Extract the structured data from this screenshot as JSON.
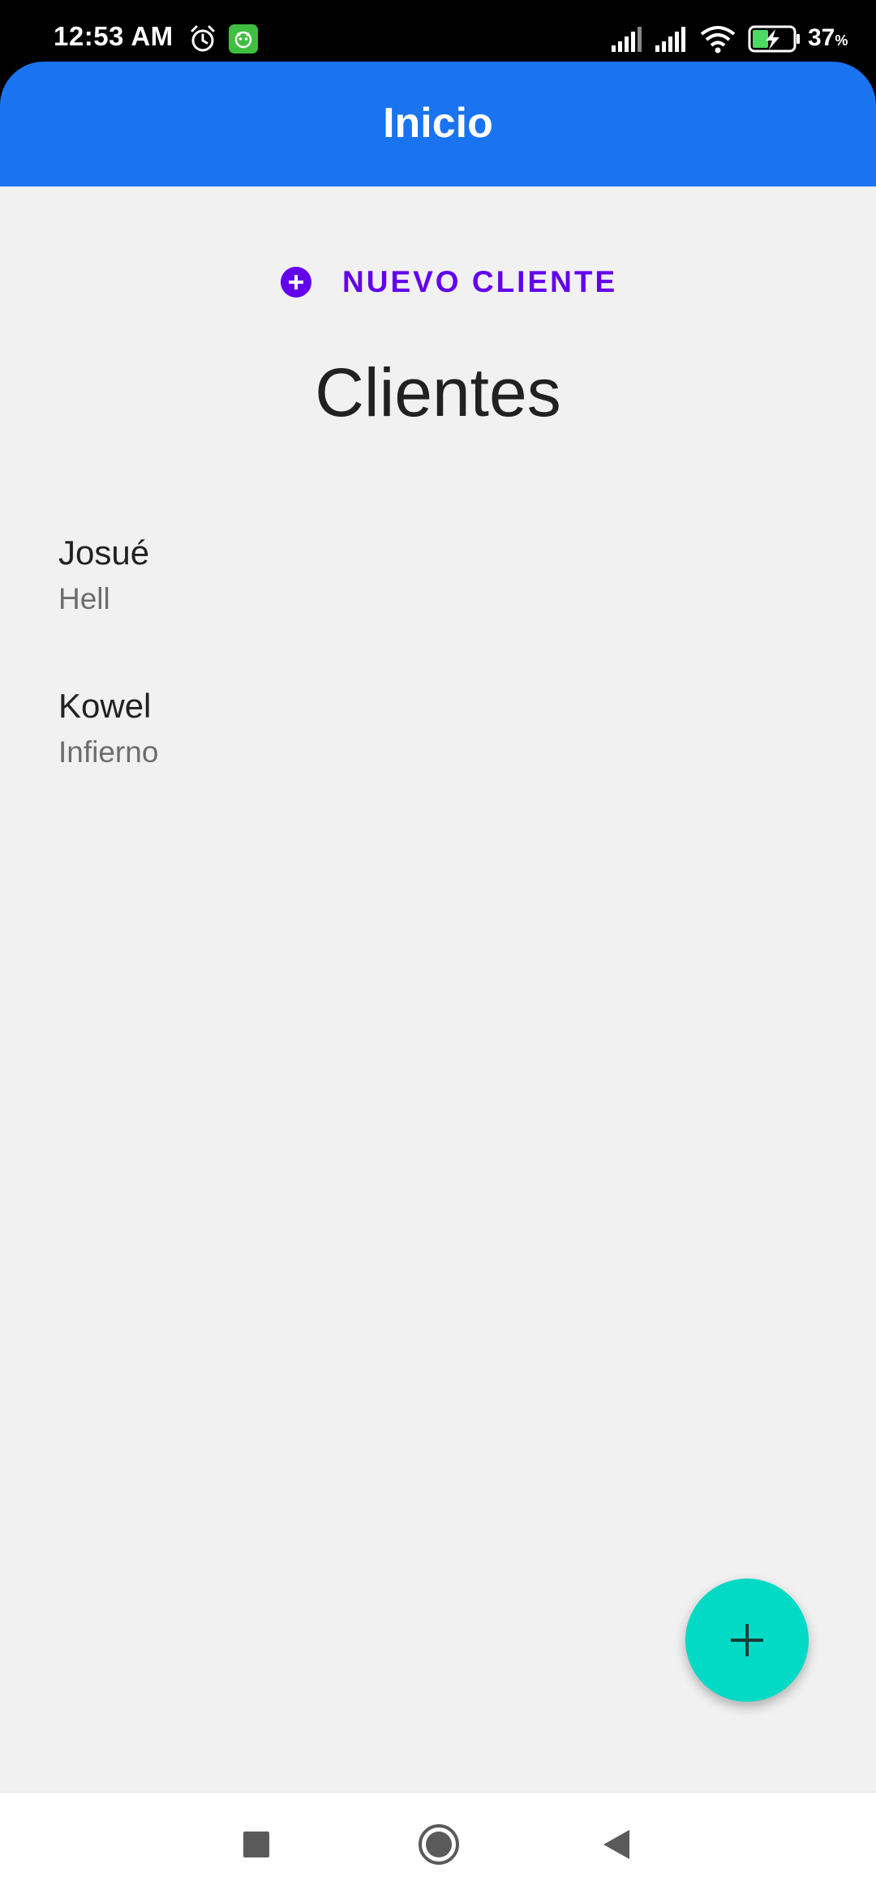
{
  "status_bar": {
    "time": "12:53 AM",
    "battery_percent": "37",
    "battery_unit": "%",
    "icons": [
      "alarm-icon",
      "app-notification-icon",
      "signal-icon",
      "signal-icon",
      "wifi-icon",
      "battery-charging-icon"
    ]
  },
  "app_bar": {
    "title": "Inicio",
    "color": "#1a73f0"
  },
  "main": {
    "new_client_button": "NUEVO CLIENTE",
    "section_title": "Clientes",
    "clients": [
      {
        "name": "Josué",
        "subtitle": "Hell"
      },
      {
        "name": "Kowel",
        "subtitle": "Infierno"
      }
    ]
  },
  "fab": {
    "icon": "add-icon",
    "color": "#03dac5"
  },
  "accent_color": "#6200ee",
  "nav_bar": {
    "buttons": [
      "recents-icon",
      "home-icon",
      "back-icon"
    ]
  }
}
